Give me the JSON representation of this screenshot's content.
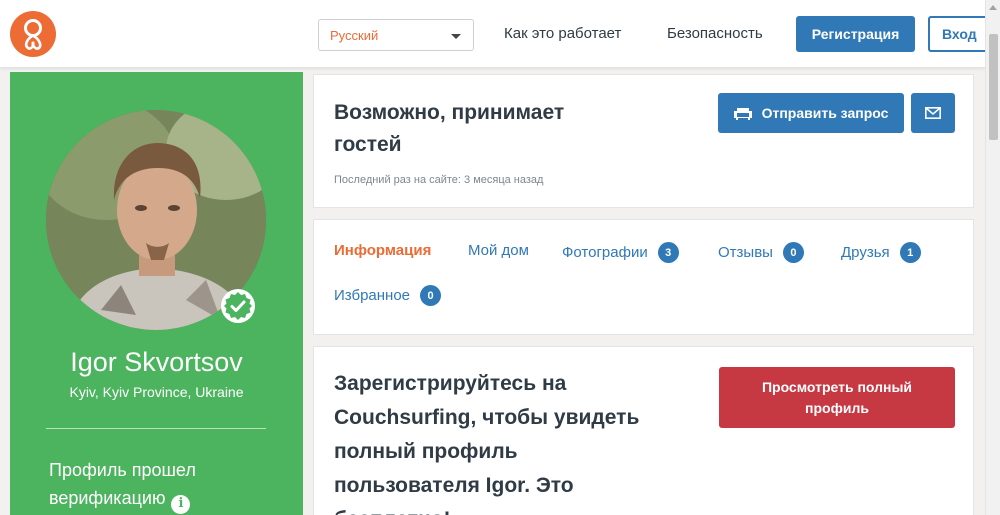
{
  "header": {
    "language": {
      "selected": "Русский"
    },
    "nav": {
      "how_it_works": "Как это работает",
      "safety": "Безопасность"
    },
    "register_label": "Регистрация",
    "login_label": "Вход"
  },
  "sidebar": {
    "name": "Igor Skvortsov",
    "location": "Kyiv, Kyiv Province, Ukraine",
    "verified_text": "Профиль прошел верификацию"
  },
  "status": {
    "title": "Возможно, принимает гостей",
    "last_seen": "Последний раз на сайте: 3 месяца назад",
    "send_request_label": "Отправить запрос"
  },
  "tabs": [
    {
      "label": "Информация"
    },
    {
      "label": "Мой дом"
    },
    {
      "label": "Фотографии",
      "count": "3"
    },
    {
      "label": "Отзывы",
      "count": "0"
    },
    {
      "label": "Друзья",
      "count": "1"
    },
    {
      "label": "Избранное",
      "count": "0"
    }
  ],
  "signup": {
    "text": "Зарегистрируйтесь на Couchsurfing, чтобы увидеть полный профиль пользователя Igor. Это бесплатно!",
    "view_full_label": "Просмотреть полный профиль"
  },
  "colors": {
    "brand_orange": "#ed6b34",
    "primary_blue": "#3079b6",
    "sidebar_green": "#4cb35f",
    "cta_red": "#c63943"
  },
  "icons": {
    "logo": "couchsurfing-logo-icon",
    "caret": "chevron-down-icon",
    "couch": "couch-icon",
    "mail": "envelope-icon",
    "verified": "checkmark-badge-icon",
    "info": "info-icon"
  }
}
